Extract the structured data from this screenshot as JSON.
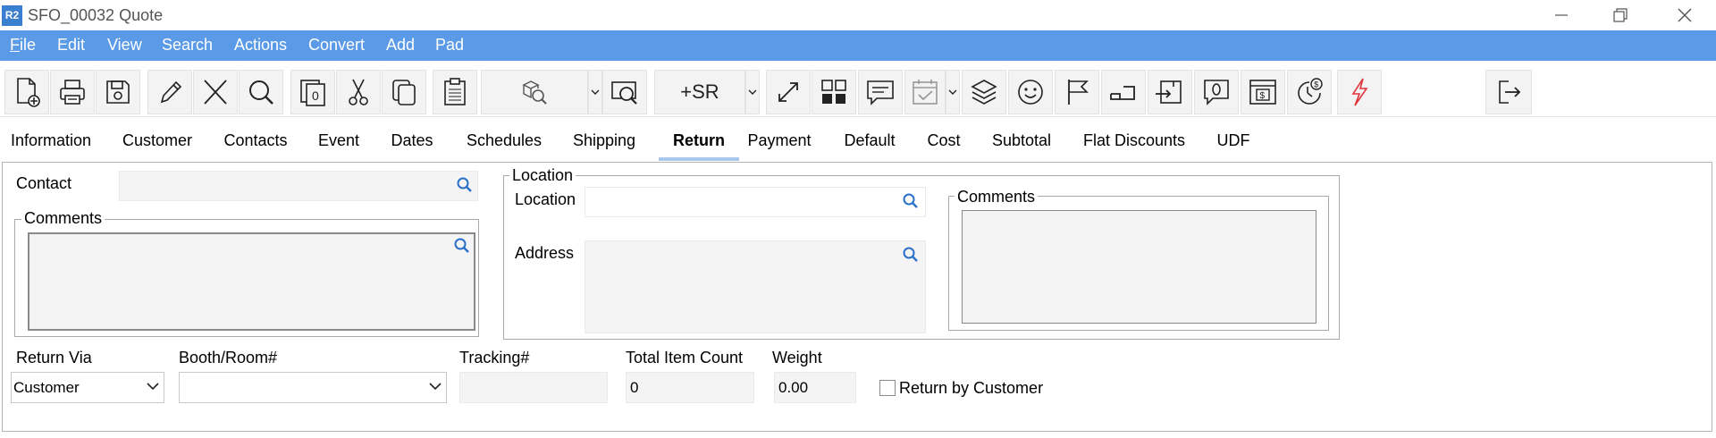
{
  "window": {
    "title": "SFO_00032 Quote",
    "logo": "R2"
  },
  "menu": [
    "File",
    "Edit",
    "View",
    "Search",
    "Actions",
    "Convert",
    "Add",
    "Pad"
  ],
  "toolbar": {
    "icons": [
      "new-document-icon",
      "print-icon",
      "save-icon",
      "edit-pencil-icon",
      "delete-x-icon",
      "search-icon",
      "copy-to-icon",
      "cut-icon",
      "duplicate-icon",
      "paste-clipboard-icon",
      "inventory-search-icon",
      "find-preview-icon",
      "add-sr-icon",
      "expand-icon",
      "grid-icon",
      "message-icon",
      "calendar-check-icon",
      "layers-icon",
      "smiley-icon",
      "flag-icon",
      "return-icon",
      "import-box-icon",
      "chat-bubble-icon",
      "invoice-icon",
      "timer-money-icon",
      "lightning-icon",
      "exit-icon"
    ],
    "add_sr_label": "+SR"
  },
  "tabs": [
    "Information",
    "Customer",
    "Contacts",
    "Event",
    "Dates",
    "Schedules",
    "Shipping",
    "Return",
    "Payment",
    "Default",
    "Cost",
    "Subtotal",
    "Flat Discounts",
    "UDF"
  ],
  "active_tab": "Return",
  "form": {
    "contact_label": "Contact",
    "contact_value": "",
    "comments_label": "Comments",
    "location_group": "Location",
    "location_label": "Location",
    "address_label": "Address",
    "right_comments_label": "Comments",
    "return_via_label": "Return Via",
    "return_via_value": "Customer",
    "booth_label": "Booth/Room#",
    "booth_value": "",
    "tracking_label": "Tracking#",
    "tracking_value": "",
    "total_count_label": "Total Item Count",
    "total_count_value": "0",
    "weight_label": "Weight",
    "weight_value": "0.00",
    "return_by_customer_label": "Return by Customer",
    "return_by_customer_checked": false
  },
  "colors": {
    "menubar": "#5a9ae6",
    "accent": "#3b7fd1",
    "lightning": "#e0333a",
    "tab_underline": "#a9c7ec"
  }
}
